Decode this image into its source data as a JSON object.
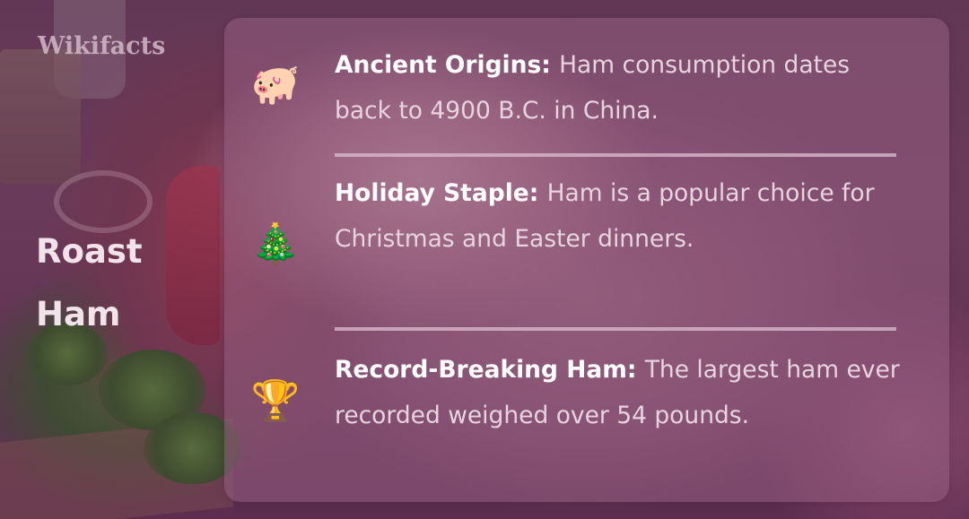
{
  "brand": "Wikifacts",
  "title": "Roast Ham",
  "facts": [
    {
      "icon": "🐖",
      "icon_name": "pig-icon",
      "heading": "Ancient Origins:",
      "text": "Ham consumption dates back to 4900 B.C. in China."
    },
    {
      "icon": "🎄",
      "icon_name": "christmas-tree-icon",
      "heading": "Holiday Staple:",
      "text": "Ham is a popular choice for Christmas and Easter dinners."
    },
    {
      "icon": "🏆",
      "icon_name": "trophy-icon",
      "heading": "Record-Breaking Ham:",
      "text": "The largest ham ever recorded weighed over 54 pounds."
    }
  ],
  "colors": {
    "card_background": "#965f82",
    "heading_text": "#ffffff",
    "body_text": "#e8d4e0",
    "divider": "#dcbed2"
  }
}
